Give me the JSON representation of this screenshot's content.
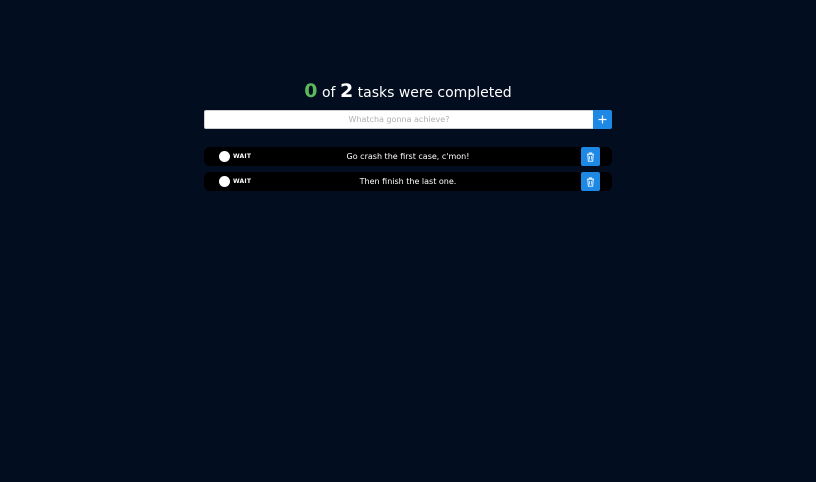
{
  "summary": {
    "completed": "0",
    "of": "of",
    "total": "2",
    "suffix": "tasks were completed"
  },
  "new_task": {
    "placeholder": "Whatcha gonna achieve?",
    "value": "",
    "add_icon": "plus-icon"
  },
  "tasks": [
    {
      "status": "WAIT",
      "text": "Go crash the first case, c'mon!",
      "check_icon": "circle-checkbox-icon",
      "delete_icon": "trash-icon"
    },
    {
      "status": "WAIT",
      "text": "Then finish the last one.",
      "check_icon": "circle-checkbox-icon",
      "delete_icon": "trash-icon"
    }
  ],
  "colors": {
    "background": "#020d1f",
    "accent": "#1e88e5",
    "completed_count": "#5cb85c",
    "task_row": "#000000"
  }
}
